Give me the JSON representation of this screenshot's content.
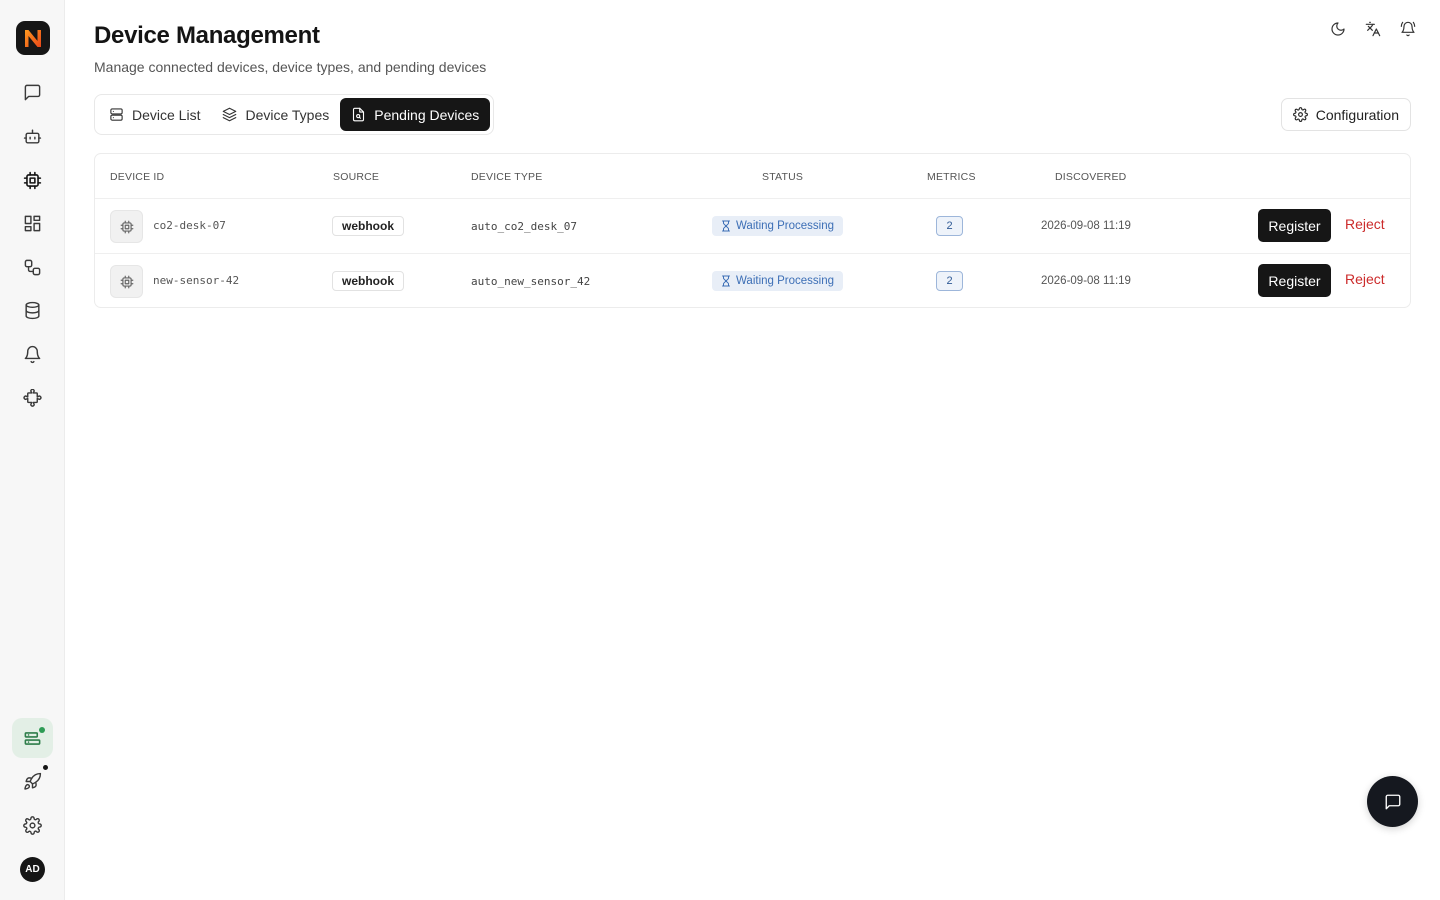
{
  "header": {
    "title": "Device Management",
    "subtitle": "Manage connected devices, device types, and pending devices"
  },
  "sidebar": {
    "logo_letter": "N",
    "avatar_initials": "AD",
    "items": [
      {
        "name": "chat",
        "icon": "message-square-icon"
      },
      {
        "name": "agents",
        "icon": "bot-icon"
      },
      {
        "name": "devices",
        "icon": "cpu-icon",
        "active": true
      },
      {
        "name": "dashboards",
        "icon": "layout-grid-icon"
      },
      {
        "name": "automations",
        "icon": "workflow-icon"
      },
      {
        "name": "data",
        "icon": "database-icon"
      },
      {
        "name": "alerts",
        "icon": "bell-icon"
      },
      {
        "name": "extensions",
        "icon": "puzzle-icon"
      },
      {
        "name": "system-status",
        "icon": "server-status-icon"
      },
      {
        "name": "updates",
        "icon": "rocket-icon"
      },
      {
        "name": "settings",
        "icon": "gear-icon"
      }
    ]
  },
  "top_actions": [
    {
      "name": "theme-toggle",
      "icon": "moon-icon"
    },
    {
      "name": "language",
      "icon": "translate-icon"
    },
    {
      "name": "notifications",
      "icon": "bell-icon"
    }
  ],
  "tabs": [
    {
      "label": "Device List",
      "icon": "list-icon",
      "active": false
    },
    {
      "label": "Device Types",
      "icon": "layers-icon",
      "active": false
    },
    {
      "label": "Pending Devices",
      "icon": "file-search-icon",
      "active": true
    }
  ],
  "config_button": {
    "label": "Configuration",
    "icon": "gear-icon"
  },
  "table": {
    "columns": [
      "DEVICE ID",
      "SOURCE",
      "DEVICE TYPE",
      "STATUS",
      "METRICS",
      "DISCOVERED"
    ],
    "rows": [
      {
        "device_id": "co2-desk-07",
        "source": "webhook",
        "device_type": "auto_co2_desk_07",
        "status": "Waiting Processing",
        "metrics": "2",
        "discovered": "2026-09-08 11:19",
        "register_label": "Register",
        "reject_label": "Reject"
      },
      {
        "device_id": "new-sensor-42",
        "source": "webhook",
        "device_type": "auto_new_sensor_42",
        "status": "Waiting Processing",
        "metrics": "2",
        "discovered": "2026-09-08 11:19",
        "register_label": "Register",
        "reject_label": "Reject"
      }
    ]
  },
  "colors": {
    "accent_dark": "#161616",
    "status_blue": "#3d6fb6",
    "reject_red": "#cc2b2b",
    "active_green": "#2e7d4a"
  }
}
